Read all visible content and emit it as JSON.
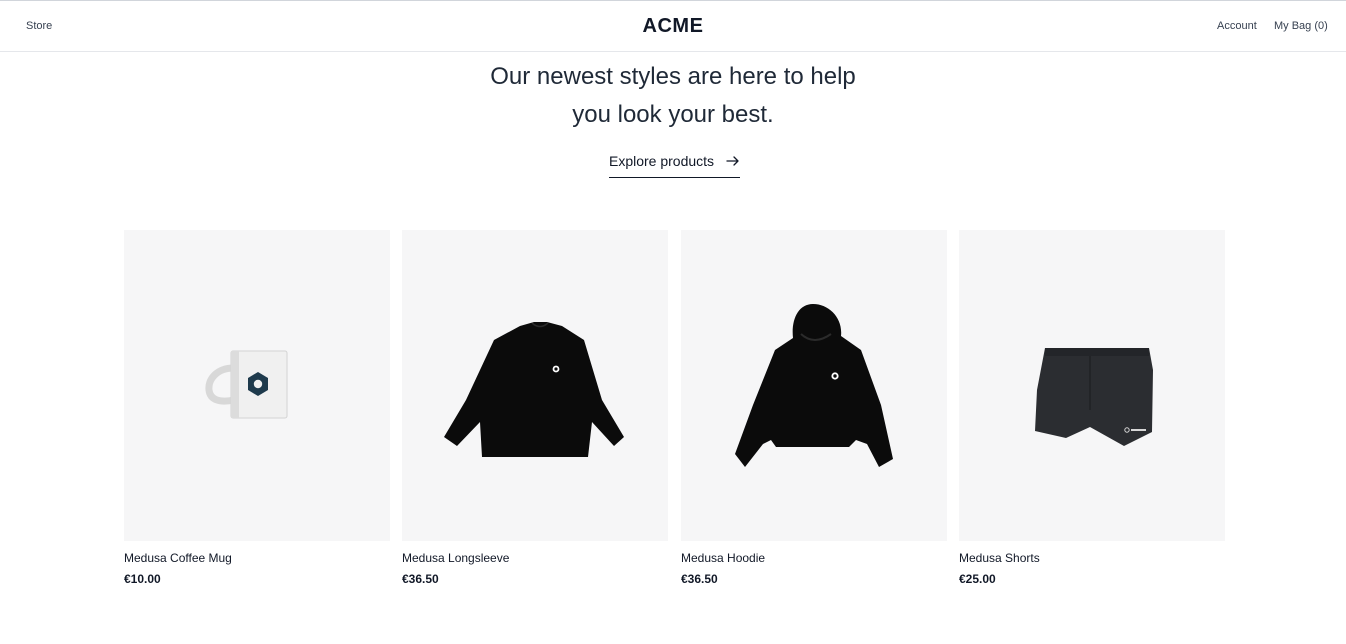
{
  "nav": {
    "store_label": "Store",
    "brand": "ACME",
    "account_label": "Account",
    "bag_label": "My Bag (0)"
  },
  "hero": {
    "line1": "Our newest styles are here to help",
    "line2": "you look your best.",
    "cta_label": "Explore products",
    "cta_icon": "arrow-right-icon"
  },
  "products": [
    {
      "title": "Medusa Coffee Mug",
      "price": "€10.00",
      "image": "coffee-mug-image"
    },
    {
      "title": "Medusa Longsleeve",
      "price": "€36.50",
      "image": "longsleeve-image"
    },
    {
      "title": "Medusa Hoodie",
      "price": "€36.50",
      "image": "hoodie-image"
    },
    {
      "title": "Medusa Shorts",
      "price": "€25.00",
      "image": "shorts-image"
    }
  ],
  "colors": {
    "text": "#111827",
    "image_bg": "#f6f6f7",
    "border": "#e5e7eb",
    "mug_logo": "#1e3a4c",
    "garment": "#0b0b0b",
    "shorts": "#2b2d31"
  }
}
